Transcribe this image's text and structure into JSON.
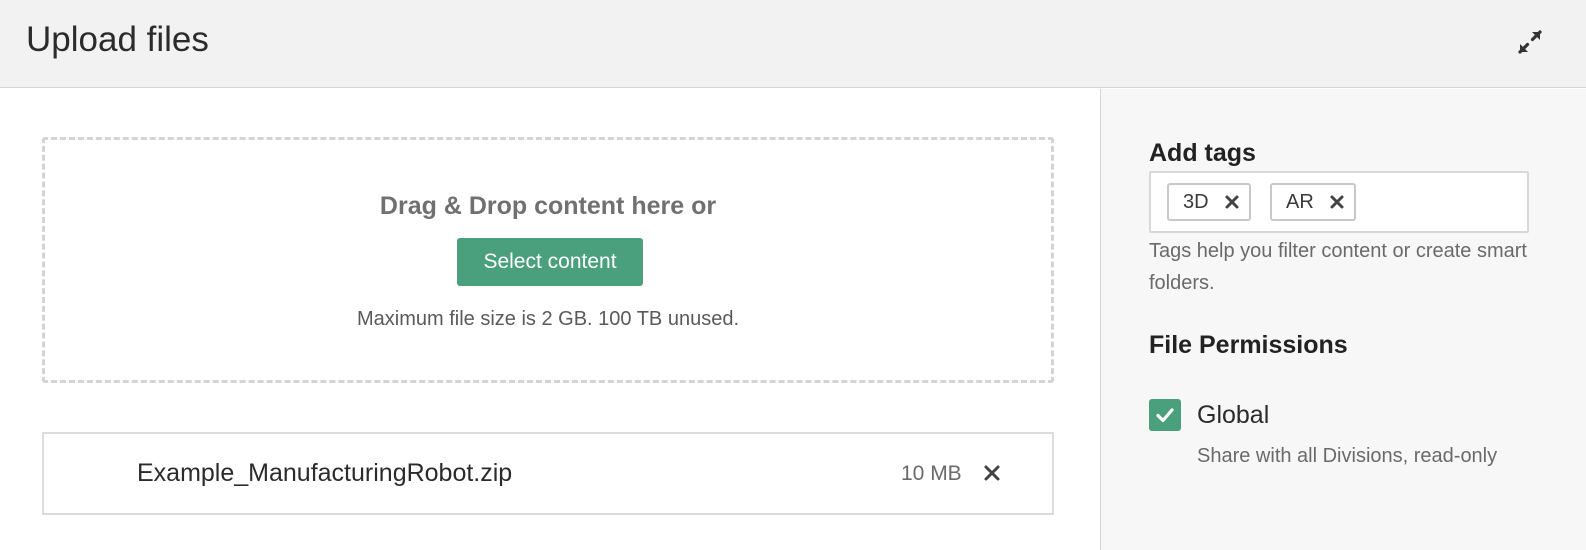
{
  "header": {
    "title": "Upload files",
    "expand_icon": "expand-icon"
  },
  "dropzone": {
    "drop_text": "Drag & Drop content here or",
    "select_button_label": "Select content",
    "size_note": "Maximum file size is 2 GB. 100 TB unused.",
    "accent_color": "#4a9f7c"
  },
  "files": [
    {
      "name": "Example_ManufacturingRobot.zip",
      "size": "10 MB",
      "remove_icon": "close-icon"
    }
  ],
  "sidebar": {
    "tags": {
      "heading": "Add tags",
      "items": [
        {
          "label": "3D",
          "remove_icon": "close-icon"
        },
        {
          "label": "AR",
          "remove_icon": "close-icon"
        }
      ],
      "help_text": "Tags help you filter content or create smart folders."
    },
    "permissions": {
      "heading": "File Permissions",
      "options": [
        {
          "label": "Global",
          "description": "Share with all Divisions, read-only",
          "checked": true,
          "icon": "checkmark-icon"
        }
      ]
    }
  }
}
